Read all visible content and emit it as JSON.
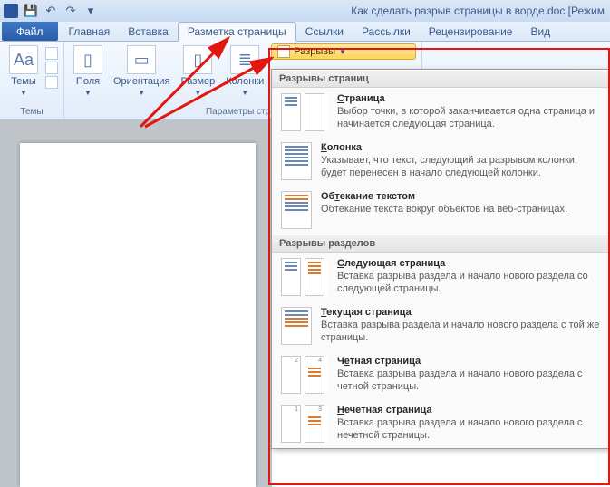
{
  "title_bar": {
    "document_title": "Как сделать разрыв страницы в ворде.doc [Режим"
  },
  "tabs": {
    "file": "Файл",
    "items": [
      "Главная",
      "Вставка",
      "Разметка страницы",
      "Ссылки",
      "Рассылки",
      "Рецензирование",
      "Вид"
    ],
    "active_index": 2
  },
  "ribbon": {
    "themes": {
      "button": "Темы",
      "group_label": "Темы"
    },
    "page_setup": {
      "fields": "Поля",
      "orientation": "Ориентация",
      "size": "Размер",
      "columns": "Колонки",
      "breaks": "Разрывы",
      "group_label": "Параметры стран"
    }
  },
  "breaks_menu": {
    "section1_header": "Разрывы страниц",
    "section2_header": "Разрывы разделов",
    "items1": [
      {
        "title_pre": "",
        "title_u": "С",
        "title_post": "траница",
        "desc": "Выбор точки, в которой заканчивается одна страница и начинается следующая страница."
      },
      {
        "title_pre": "",
        "title_u": "К",
        "title_post": "олонка",
        "desc": "Указывает, что текст, следующий за разрывом колонки, будет перенесен в начало следующей колонки."
      },
      {
        "title_pre": "Об",
        "title_u": "т",
        "title_post": "екание текстом",
        "desc": "Обтекание текста вокруг объектов на веб-страницах."
      }
    ],
    "items2": [
      {
        "title_pre": "",
        "title_u": "С",
        "title_post": "ледующая страница",
        "desc": "Вставка разрыва раздела и начало нового раздела со следующей страницы."
      },
      {
        "title_pre": "",
        "title_u": "Т",
        "title_post": "екущая страница",
        "desc": "Вставка разрыва раздела и начало нового раздела с той же страницы."
      },
      {
        "title_pre": "Ч",
        "title_u": "е",
        "title_post": "тная страница",
        "desc": "Вставка разрыва раздела и начало нового раздела с четной страницы."
      },
      {
        "title_pre": "",
        "title_u": "Н",
        "title_post": "ечетная страница",
        "desc": "Вставка разрыва раздела и начало нового раздела с нечетной страницы."
      }
    ]
  }
}
